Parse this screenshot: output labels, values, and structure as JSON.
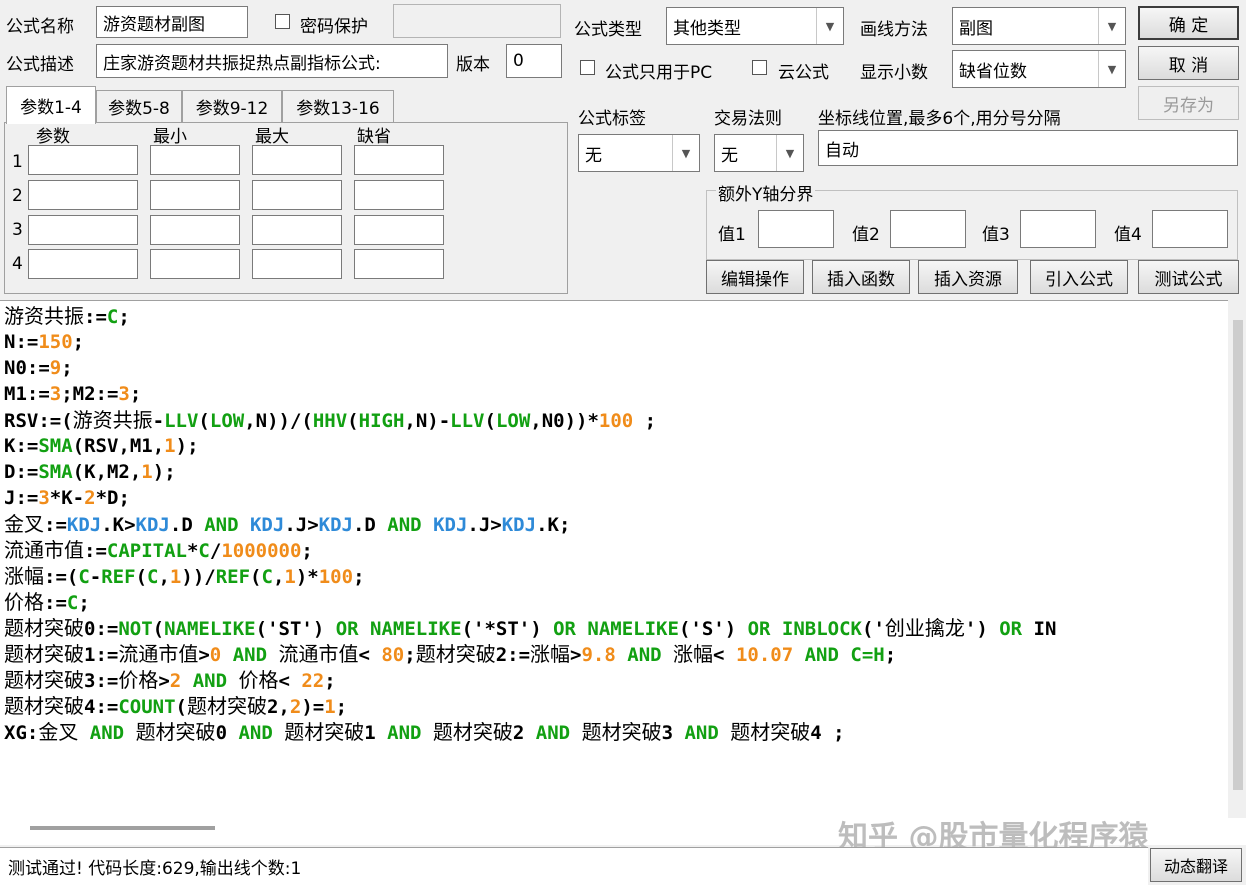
{
  "form": {
    "name_label": "公式名称",
    "name_value": "游资题材副图",
    "password_label": "密码保护",
    "desc_label": "公式描述",
    "desc_value": "庄家游资题材共振捉热点副指标公式:",
    "version_label": "版本",
    "version_value": "0",
    "type_label": "公式类型",
    "type_value": "其他类型",
    "draw_label": "画线方法",
    "draw_value": "副图",
    "pc_only_label": "公式只用于PC",
    "cloud_label": "云公式",
    "decimals_label": "显示小数",
    "decimals_value": "缺省位数",
    "tag_label": "公式标签",
    "tag_value": "无",
    "trade_label": "交易法则",
    "trade_value": "无",
    "axis_label": "坐标线位置,最多6个,用分号分隔",
    "axis_value": "自动",
    "extra_y_label": "额外Y轴分界",
    "val1": "值1",
    "val2": "值2",
    "val3": "值3",
    "val4": "值4"
  },
  "buttons": {
    "ok": "确  定",
    "cancel": "取  消",
    "save_as": "另存为",
    "edit": "编辑操作",
    "insert_func": "插入函数",
    "insert_res": "插入资源",
    "import": "引入公式",
    "test": "测试公式",
    "dyn_translate": "动态翻译"
  },
  "tabs": [
    "参数1-4",
    "参数5-8",
    "参数9-12",
    "参数13-16"
  ],
  "param_headers": [
    "参数",
    "最小",
    "最大",
    "缺省"
  ],
  "param_rows": [
    "1",
    "2",
    "3",
    "4"
  ],
  "code_lines": [
    [
      [
        "游资共振",
        "cn"
      ],
      [
        ":=",
        "plain"
      ],
      [
        "C",
        "green"
      ],
      [
        ";",
        "plain"
      ]
    ],
    [
      [
        "N:=",
        "plain"
      ],
      [
        "150",
        "orange"
      ],
      [
        ";",
        "plain"
      ]
    ],
    [
      [
        "N0:=",
        "plain"
      ],
      [
        "9",
        "orange"
      ],
      [
        ";",
        "plain"
      ]
    ],
    [
      [
        "M1:=",
        "plain"
      ],
      [
        "3",
        "orange"
      ],
      [
        ";M2:=",
        "plain"
      ],
      [
        "3",
        "orange"
      ],
      [
        ";",
        "plain"
      ]
    ],
    [
      [
        "RSV:=(",
        "plain"
      ],
      [
        "游资共振",
        "cn"
      ],
      [
        "-",
        "plain"
      ],
      [
        "LLV",
        "green"
      ],
      [
        "(",
        "plain"
      ],
      [
        "LOW",
        "green"
      ],
      [
        ",N))/(",
        "plain"
      ],
      [
        "HHV",
        "green"
      ],
      [
        "(",
        "plain"
      ],
      [
        "HIGH",
        "green"
      ],
      [
        ",N)-",
        "plain"
      ],
      [
        "LLV",
        "green"
      ],
      [
        "(",
        "plain"
      ],
      [
        "LOW",
        "green"
      ],
      [
        ",N0))*",
        "plain"
      ],
      [
        "100",
        "orange"
      ],
      [
        " ;",
        "plain"
      ]
    ],
    [
      [
        "K:=",
        "plain"
      ],
      [
        "SMA",
        "green"
      ],
      [
        "(RSV,M1,",
        "plain"
      ],
      [
        "1",
        "orange"
      ],
      [
        ");",
        "plain"
      ]
    ],
    [
      [
        "D:=",
        "plain"
      ],
      [
        "SMA",
        "green"
      ],
      [
        "(K,M2,",
        "plain"
      ],
      [
        "1",
        "orange"
      ],
      [
        ");",
        "plain"
      ]
    ],
    [
      [
        "J:=",
        "plain"
      ],
      [
        "3",
        "orange"
      ],
      [
        "*K-",
        "plain"
      ],
      [
        "2",
        "orange"
      ],
      [
        "*D;",
        "plain"
      ]
    ],
    [
      [
        "金叉",
        "cn"
      ],
      [
        ":=",
        "plain"
      ],
      [
        "KDJ",
        "blue"
      ],
      [
        ".K>",
        "plain"
      ],
      [
        "KDJ",
        "blue"
      ],
      [
        ".D ",
        "plain"
      ],
      [
        "AND",
        "green"
      ],
      [
        " ",
        "plain"
      ],
      [
        "KDJ",
        "blue"
      ],
      [
        ".J>",
        "plain"
      ],
      [
        "KDJ",
        "blue"
      ],
      [
        ".D ",
        "plain"
      ],
      [
        "AND",
        "green"
      ],
      [
        " ",
        "plain"
      ],
      [
        "KDJ",
        "blue"
      ],
      [
        ".J>",
        "plain"
      ],
      [
        "KDJ",
        "blue"
      ],
      [
        ".K;",
        "plain"
      ]
    ],
    [
      [
        "流通市值",
        "cn"
      ],
      [
        ":=",
        "plain"
      ],
      [
        "CAPITAL",
        "green"
      ],
      [
        "*",
        "plain"
      ],
      [
        "C",
        "green"
      ],
      [
        "/",
        "plain"
      ],
      [
        "1000000",
        "orange"
      ],
      [
        ";",
        "plain"
      ]
    ],
    [
      [
        "涨幅",
        "cn"
      ],
      [
        ":=(",
        "plain"
      ],
      [
        "C",
        "green"
      ],
      [
        "-",
        "plain"
      ],
      [
        "REF",
        "green"
      ],
      [
        "(",
        "plain"
      ],
      [
        "C",
        "green"
      ],
      [
        ",",
        "plain"
      ],
      [
        "1",
        "orange"
      ],
      [
        "))/",
        "plain"
      ],
      [
        "REF",
        "green"
      ],
      [
        "(",
        "plain"
      ],
      [
        "C",
        "green"
      ],
      [
        ",",
        "plain"
      ],
      [
        "1",
        "orange"
      ],
      [
        ")*",
        "plain"
      ],
      [
        "100",
        "orange"
      ],
      [
        ";",
        "plain"
      ]
    ],
    [
      [
        "价格",
        "cn"
      ],
      [
        ":=",
        "plain"
      ],
      [
        "C",
        "green"
      ],
      [
        ";",
        "plain"
      ]
    ],
    [
      [
        "题材突破",
        "cn"
      ],
      [
        "0:=",
        "plain"
      ],
      [
        "NOT",
        "green"
      ],
      [
        "(",
        "plain"
      ],
      [
        "NAMELIKE",
        "green"
      ],
      [
        "('ST') ",
        "plain"
      ],
      [
        "OR",
        "green"
      ],
      [
        " ",
        "plain"
      ],
      [
        "NAMELIKE",
        "green"
      ],
      [
        "('*ST') ",
        "plain"
      ],
      [
        "OR",
        "green"
      ],
      [
        " ",
        "plain"
      ],
      [
        "NAMELIKE",
        "green"
      ],
      [
        "('S') ",
        "plain"
      ],
      [
        "OR",
        "green"
      ],
      [
        " ",
        "plain"
      ],
      [
        "INBLOCK",
        "green"
      ],
      [
        "('",
        "plain"
      ],
      [
        "创业擒龙",
        "cn"
      ],
      [
        "') ",
        "plain"
      ],
      [
        "OR",
        "green"
      ],
      [
        " IN",
        "plain"
      ]
    ],
    [
      [
        "题材突破",
        "cn"
      ],
      [
        "1:=",
        "plain"
      ],
      [
        "流通市值",
        "cn"
      ],
      [
        ">",
        "plain"
      ],
      [
        "0",
        "orange"
      ],
      [
        " ",
        "plain"
      ],
      [
        "AND",
        "green"
      ],
      [
        " ",
        "plain"
      ],
      [
        "流通市值",
        "cn"
      ],
      [
        "< ",
        "plain"
      ],
      [
        "80",
        "orange"
      ],
      [
        ";",
        "plain"
      ],
      [
        "题材突破",
        "cn"
      ],
      [
        "2:=",
        "plain"
      ],
      [
        "涨幅",
        "cn"
      ],
      [
        ">",
        "plain"
      ],
      [
        "9.8",
        "orange"
      ],
      [
        " ",
        "plain"
      ],
      [
        "AND",
        "green"
      ],
      [
        " ",
        "plain"
      ],
      [
        "涨幅",
        "cn"
      ],
      [
        "< ",
        "plain"
      ],
      [
        "10.07",
        "orange"
      ],
      [
        " ",
        "plain"
      ],
      [
        "AND",
        "green"
      ],
      [
        " ",
        "plain"
      ],
      [
        "C=H",
        "green"
      ],
      [
        ";",
        "plain"
      ]
    ],
    [
      [
        "题材突破",
        "cn"
      ],
      [
        "3:=",
        "plain"
      ],
      [
        "价格",
        "cn"
      ],
      [
        ">",
        "plain"
      ],
      [
        "2",
        "orange"
      ],
      [
        " ",
        "plain"
      ],
      [
        "AND",
        "green"
      ],
      [
        " ",
        "plain"
      ],
      [
        "价格",
        "cn"
      ],
      [
        "< ",
        "plain"
      ],
      [
        "22",
        "orange"
      ],
      [
        ";",
        "plain"
      ]
    ],
    [
      [
        "题材突破",
        "cn"
      ],
      [
        "4:=",
        "plain"
      ],
      [
        "COUNT",
        "green"
      ],
      [
        "(",
        "plain"
      ],
      [
        "题材突破",
        "cn"
      ],
      [
        "2,",
        "plain"
      ],
      [
        "2",
        "orange"
      ],
      [
        ")=",
        "plain"
      ],
      [
        "1",
        "orange"
      ],
      [
        ";",
        "plain"
      ]
    ],
    [
      [
        "XG:",
        "plain"
      ],
      [
        "金叉",
        "cn"
      ],
      [
        " ",
        "plain"
      ],
      [
        "AND",
        "green"
      ],
      [
        " ",
        "plain"
      ],
      [
        "题材突破",
        "cn"
      ],
      [
        "0 ",
        "plain"
      ],
      [
        "AND",
        "green"
      ],
      [
        " ",
        "plain"
      ],
      [
        "题材突破",
        "cn"
      ],
      [
        "1 ",
        "plain"
      ],
      [
        "AND",
        "green"
      ],
      [
        " ",
        "plain"
      ],
      [
        "题材突破",
        "cn"
      ],
      [
        "2 ",
        "plain"
      ],
      [
        "AND",
        "green"
      ],
      [
        " ",
        "plain"
      ],
      [
        "题材突破",
        "cn"
      ],
      [
        "3 ",
        "plain"
      ],
      [
        "AND",
        "green"
      ],
      [
        " ",
        "plain"
      ],
      [
        "题材突破",
        "cn"
      ],
      [
        "4 ;",
        "plain"
      ]
    ]
  ],
  "status": "测试通过! 代码长度:629,输出线个数:1",
  "watermark": "知乎 @股市量化程序猿"
}
